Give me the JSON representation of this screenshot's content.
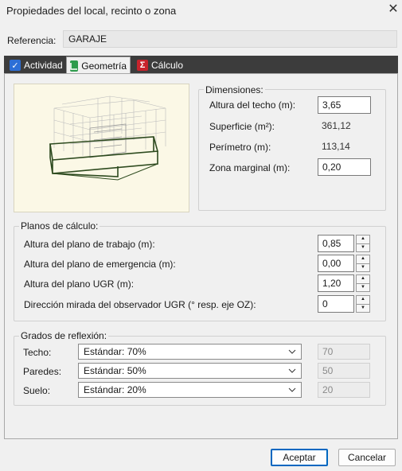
{
  "window": {
    "title": "Propiedades del local, recinto o zona",
    "close": "✕"
  },
  "referencia": {
    "label": "Referencia:",
    "value": "GARAJE"
  },
  "tabs": [
    {
      "label": "Actividad",
      "icon": "check-icon"
    },
    {
      "label": "Geometría",
      "icon": "geometry-icon"
    },
    {
      "label": "Cálculo",
      "icon": "sigma-icon"
    }
  ],
  "dimensiones": {
    "legend": "Dimensiones:",
    "altura_techo": {
      "label": "Altura del techo (m):",
      "value": "3,65"
    },
    "superficie": {
      "label": "Superficie (m²):",
      "value": "361,12"
    },
    "perimetro": {
      "label": "Perímetro (m):",
      "value": "113,14"
    },
    "zona_marginal": {
      "label": "Zona marginal (m):",
      "value": "0,20"
    }
  },
  "planos": {
    "legend": "Planos de cálculo:",
    "trabajo": {
      "label": "Altura del plano de trabajo (m):",
      "value": "0,85"
    },
    "emergencia": {
      "label": "Altura del plano de emergencia (m):",
      "value": "0,00"
    },
    "ugr": {
      "label": "Altura del plano UGR (m):",
      "value": "1,20"
    },
    "direccion": {
      "label": "Dirección mirada del observador UGR (° resp. eje OZ):",
      "value": "0"
    }
  },
  "reflexion": {
    "legend": "Grados de reflexión:",
    "techo": {
      "label": "Techo:",
      "option": "Estándar: 70%",
      "value": "70"
    },
    "paredes": {
      "label": "Paredes:",
      "option": "Estándar: 50%",
      "value": "50"
    },
    "suelo": {
      "label": "Suelo:",
      "option": "Estándar: 20%",
      "value": "20"
    }
  },
  "buttons": {
    "aceptar": "Aceptar",
    "cancelar": "Cancelar"
  },
  "colors": {
    "accent": "#0067c0",
    "tab_strip": "#3c3c3c",
    "preview_bg": "#fbf8e6",
    "model_outline": "#2d4a1e"
  }
}
